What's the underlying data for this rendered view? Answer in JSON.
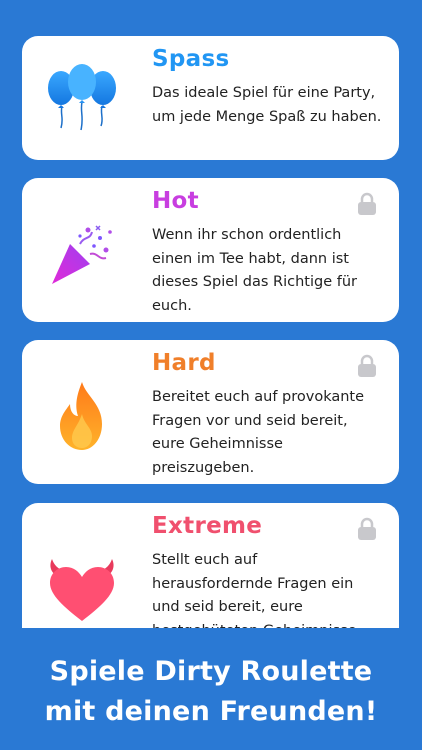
{
  "modes": [
    {
      "title": "Spass",
      "description": "Das ideale Spiel für eine Party, um jede Menge Spaß zu haben.",
      "color": "#2196f3",
      "icon": "balloons-icon",
      "locked": false
    },
    {
      "title": "Hot",
      "description": "Wenn ihr schon ordentlich einen im Tee habt, dann ist dieses Spiel das Richtige für euch.",
      "color": "#c83ee0",
      "icon": "party-popper-icon",
      "locked": true
    },
    {
      "title": "Hard",
      "description": "Bereitet euch auf provokante Fragen vor und seid bereit, eure Geheimnisse preiszugeben.",
      "color": "#f07f2a",
      "icon": "flame-icon",
      "locked": true
    },
    {
      "title": "Extreme",
      "description": "Stellt euch auf herausfordernde Fragen ein und seid bereit, eure bestgehüteten Geheimnisse",
      "color": "#f0506e",
      "icon": "devil-heart-icon",
      "locked": true
    }
  ],
  "footer": {
    "line1": "Spiele Dirty Roulette",
    "line2": "mit deinen Freunden!"
  },
  "colors": {
    "background": "#2a79d4",
    "card": "#ffffff",
    "lock": "#c8c8cc"
  }
}
